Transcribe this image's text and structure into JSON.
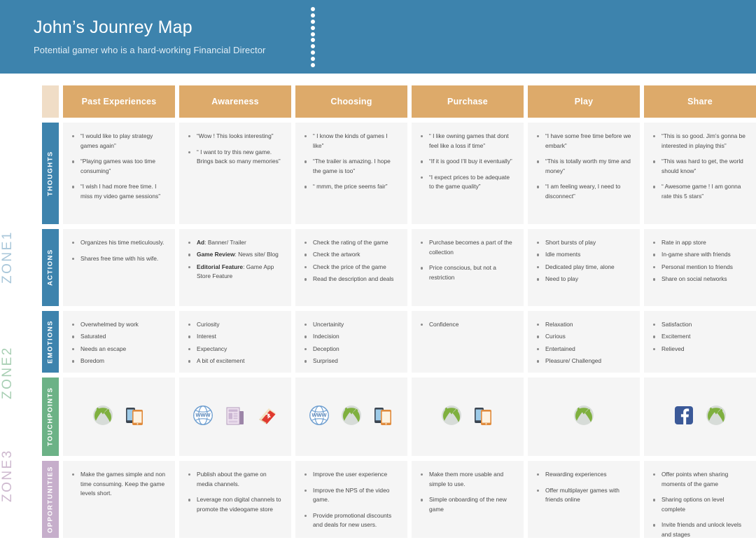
{
  "header": {
    "title": "John’s Jounrey Map",
    "subtitle": "Potential gamer who is a hard-working Financial Director",
    "bg_color": "#3d83ad"
  },
  "colors": {
    "header_blue": "#3d83ad",
    "column_header": "#ddaa6a",
    "corner_block": "#f0ddc6",
    "row_blue": "#3d83ad",
    "row_green": "#6cb286",
    "row_purple": "#c6aecb",
    "cell_bg": "#f5f5f5",
    "zone1": "#a9c7da",
    "zone2": "#a8cfb4",
    "zone3": "#ceb9cf"
  },
  "zones": [
    {
      "label": "ZONE1"
    },
    {
      "label": "ZONE2"
    },
    {
      "label": "ZONE3"
    }
  ],
  "columns": [
    {
      "label": "Past Experiences"
    },
    {
      "label": "Awareness"
    },
    {
      "label": "Choosing"
    },
    {
      "label": "Purchase"
    },
    {
      "label": "Play"
    },
    {
      "label": "Share"
    }
  ],
  "rows": {
    "thoughts": {
      "label": "THOUGHTS",
      "cells": [
        [
          "“I would like to play strategy games again”",
          "“Playing games was too time consuming”",
          "“I wish I had more free time. I miss my video game sessions”"
        ],
        [
          "“Wow ! This looks interesting”",
          "“ I want to try this new game. Brings back so many memories”"
        ],
        [
          "“ I know the kinds of games I like”",
          "“The trailer is amazing. I hope the game is too”",
          "“ mmm, the price seems fair”"
        ],
        [
          "“ I like owning games that dont feel like a loss if time”",
          "“If it is good I’ll buy it eventually”",
          "“I expect prices to be adequate to the game quality”"
        ],
        [
          "“I have some free time before we embark”",
          "“This is totally worth my time and money”",
          "“I am feeling weary, I need to disconnect”"
        ],
        [
          "“This is so good. Jim’s gonna be interested in playing this”",
          "“This was hard to get, the world should know”",
          "“ Awesome game ! I am gonna rate this 5 stars”"
        ]
      ]
    },
    "actions": {
      "label": "ACTIONS",
      "cells": [
        [
          {
            "text": "Organizes his time meticulously."
          },
          {
            "text": "Shares free time with his wife."
          }
        ],
        [
          {
            "bold": "Ad",
            "text": ": Banner/ Trailer"
          },
          {
            "bold": "Game Review",
            "text": ": News site/ Blog"
          },
          {
            "bold": "Editorial Feature",
            "text": ": Game App Store Feature"
          }
        ],
        [
          {
            "text": "Check the rating of the game"
          },
          {
            "text": "Check the artwork"
          },
          {
            "text": "Check the price of the game"
          },
          {
            "text": "Read the description and deals"
          }
        ],
        [
          {
            "text": "Purchase becomes a part of the collection"
          },
          {
            "text": "Price conscious, but not a restriction"
          }
        ],
        [
          {
            "text": "Short bursts of play"
          },
          {
            "text": "Idle moments"
          },
          {
            "text": "Dedicated play time, alone"
          },
          {
            "text": "Need to play"
          }
        ],
        [
          {
            "text": "Rate in app store"
          },
          {
            "text": "In-game share with friends"
          },
          {
            "text": "Personal mention to friends"
          },
          {
            "text": "Share on social networks"
          }
        ]
      ]
    },
    "emotions": {
      "label": "EMOTIONS",
      "cells": [
        [
          "Overwhelmed by work",
          "Saturated",
          "Needs an escape",
          "Boredom"
        ],
        [
          "Curiosity",
          "Interest",
          "Expectancy",
          "A bit of excitement"
        ],
        [
          "Uncertainity",
          "Indecision",
          "Deception",
          "Surprised"
        ],
        [
          "Confidence"
        ],
        [
          "Relaxation",
          "Curious",
          "Entertained",
          "Pleasure/ Challenged"
        ],
        [
          "Satisfaction",
          "Excitement",
          "Relieved"
        ]
      ]
    },
    "touchpoints": {
      "label": "TOUCHPOINTS",
      "cells": [
        [
          "xbox-icon",
          "mobile-devices-icon"
        ],
        [
          "www-globe-icon",
          "newspaper-icon",
          "magazine-icon"
        ],
        [
          "www-globe-icon",
          "xbox-icon",
          "mobile-devices-icon"
        ],
        [
          "xbox-icon",
          "mobile-devices-icon"
        ],
        [
          "xbox-icon"
        ],
        [
          "facebook-icon",
          "xbox-icon"
        ]
      ]
    },
    "opportunities": {
      "label": "OPPORTUNITIES",
      "cells": [
        [
          "Make the games simple and non time consuming. Keep the game levels short."
        ],
        [
          "Publish about the game on media channels.",
          "Leverage non digital channels to promote the videogame store"
        ],
        [
          "Improve the user experience",
          "Improve the NPS of the video game.",
          "Provide promotional discounts and deals for new users."
        ],
        [
          "Make them more usable and simple to use.",
          "Simple onboarding of the new game"
        ],
        [
          "Rewarding experiences",
          "Offer multiplayer games with friends online"
        ],
        [
          "Offer points when sharing moments of the game",
          "Sharing options on level complete",
          "Invite friends and unlock levels and stages"
        ]
      ]
    }
  }
}
